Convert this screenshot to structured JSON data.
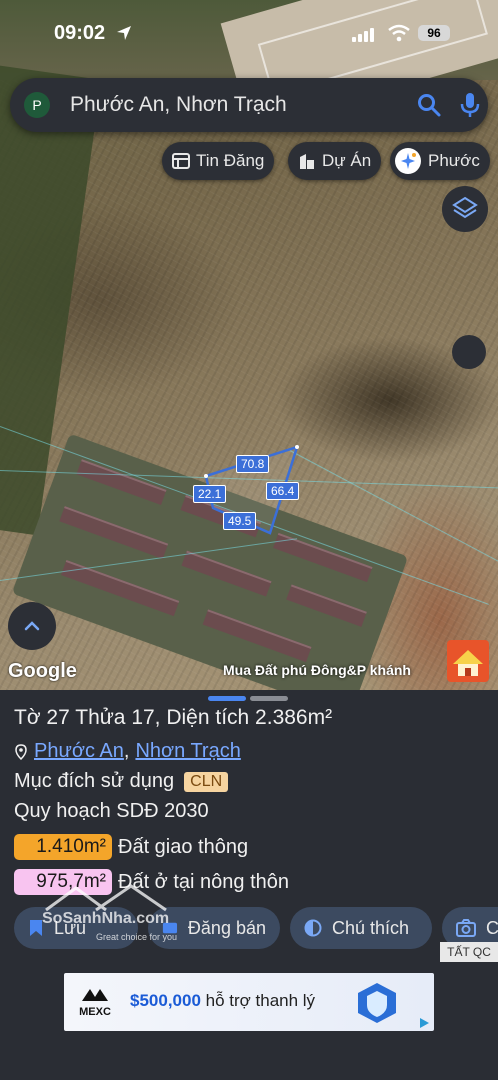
{
  "status_bar": {
    "time": "09:02",
    "battery": "96"
  },
  "search": {
    "avatar_letter": "P",
    "query": "Phước An, Nhơn Trạch"
  },
  "chips": [
    {
      "label": "Tin Đăng",
      "icon": "listing-icon"
    },
    {
      "label": "Dự Án",
      "icon": "building-icon"
    },
    {
      "label": "Phước",
      "icon": "sparkle-avatar-icon"
    }
  ],
  "map": {
    "plot_edges": [
      "70.8",
      "22.1",
      "66.4",
      "49.5"
    ],
    "google_logo": "Google",
    "ad_caption": "Mua Đất phú Đông&P khánh"
  },
  "sheet": {
    "title": "Tờ 27 Thửa 17, Diện tích 2.386m²",
    "address": {
      "ward": "Phước An",
      "separator": ",",
      "district": "Nhơn Trạch"
    },
    "purpose": {
      "label": "Mục đích sử dụng",
      "code": "CLN"
    },
    "plan_label": "Quy hoạch SDĐ 2030",
    "zones": [
      {
        "area": "1.410m²",
        "name": "Đất giao thông",
        "color": "#f4a52a"
      },
      {
        "area": "975,7m²",
        "name": "Đất ở tại nông thôn",
        "color": "#f8c4f0"
      }
    ],
    "actions": [
      {
        "label": "Lưu",
        "icon": "bookmark-icon"
      },
      {
        "label": "Đăng bán",
        "icon": "tag-icon"
      },
      {
        "label": "Chú thích",
        "icon": "contrast-icon"
      },
      {
        "label": "C",
        "icon": "camera-icon"
      }
    ],
    "watermark": {
      "brand": "SoSanhNha.com",
      "tagline": "Great choice for you"
    },
    "ad_close": "TẤT QC",
    "ad": {
      "brand": "MEXC",
      "amount": "$500,000",
      "text": " hỗ trợ thanh lý"
    }
  },
  "colors": {
    "accent": "#4a86f0",
    "link": "#79a8ff",
    "panel": "#2c2f36"
  }
}
